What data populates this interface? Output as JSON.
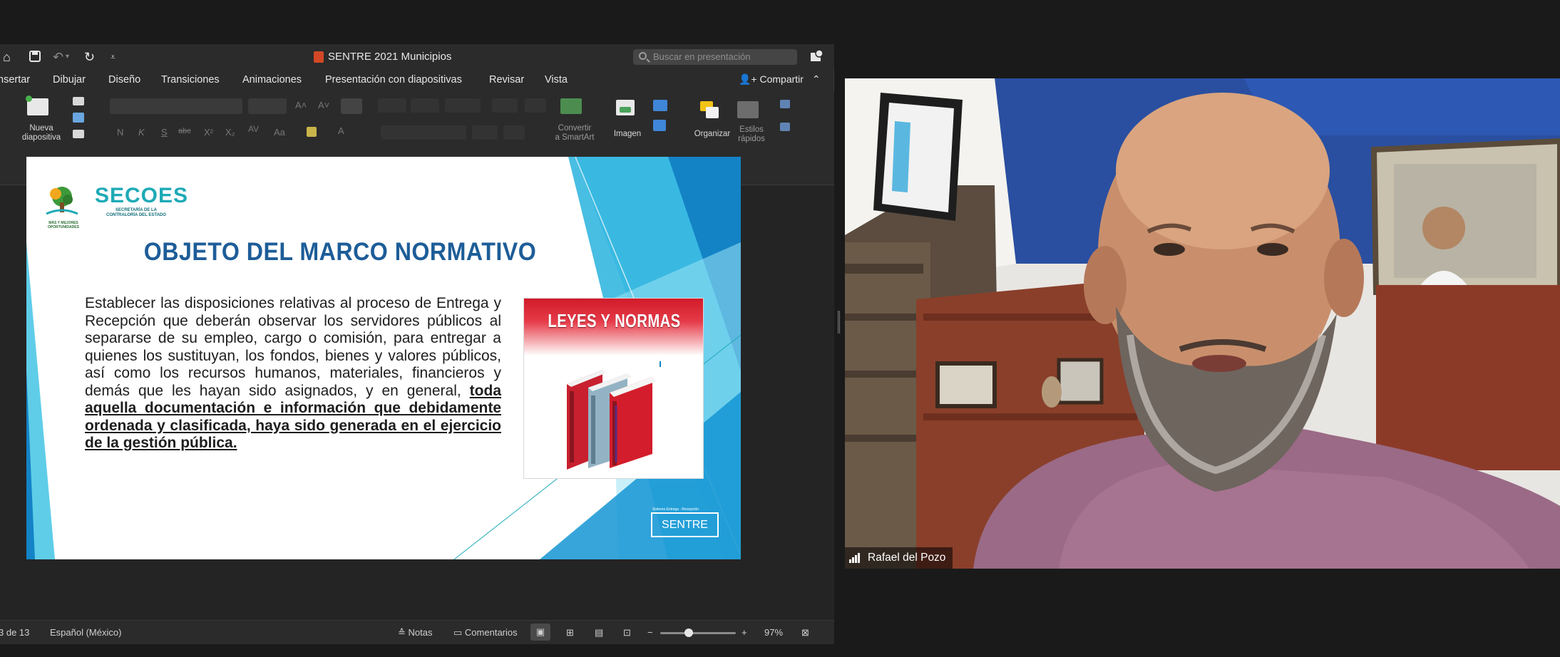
{
  "ppt": {
    "doc_title": "SENTRE 2021 Municipios",
    "search_placeholder": "Buscar en presentación",
    "menu_tabs": [
      "nsertar",
      "Dibujar",
      "Diseño",
      "Transiciones",
      "Animaciones",
      "Presentación con diapositivas",
      "Revisar",
      "Vista"
    ],
    "share_label": "Compartir",
    "ribbon": {
      "new_slide": "Nueva\ndiapositiva",
      "convert_smartart": "Convertir\na SmartArt",
      "image": "Imagen",
      "organize": "Organizar",
      "quick_styles": "Estilos\nrápidos",
      "format_letters": [
        "N",
        "K",
        "S",
        "abc",
        "X²",
        "X₂",
        "AV",
        "Aa",
        "A"
      ]
    },
    "slide": {
      "logo_name": "SECOES",
      "logo_subtitle": "SECRETARÍA DE LA CONTRALORÍA DEL ESTADO",
      "logo_tree_caption": "MÁS Y MEJORES OPORTUNIDADES",
      "title": "OBJETO DEL MARCO NORMATIVO",
      "body_plain": "Establecer las disposiciones relativas al proceso de Entrega y Recepción que deberán observar los servidores públicos al separarse de su empleo, cargo o comisión, para entregar a quienes los sustituyan, los fondos, bienes y valores públicos, así como los recursos humanos, materiales, financieros y demás que les hayan sido asignados, y en general, ",
      "body_strong": "toda aquella documentación e información que debidamente ordenada y clasificada, haya sido generada en el ejercicio de la gestión pública.",
      "card_title": "LEYES Y NORMAS",
      "sentre_small": "Sistema Entrega - Recepción",
      "sentre_label": "SENTRE"
    },
    "status": {
      "slide_count": "3 de 13",
      "language": "Español (México)",
      "notes": "Notas",
      "comments": "Comentarios",
      "zoom": "97%",
      "zoom_fraction": 0.38
    }
  },
  "video": {
    "participant_name": "Rafael del Pozo"
  },
  "colors": {
    "slide_title": "#1d5d98",
    "slide_accent": "#1eaab7",
    "card_red": "#d11a2a",
    "wall_blue": "#2a4fa0"
  }
}
